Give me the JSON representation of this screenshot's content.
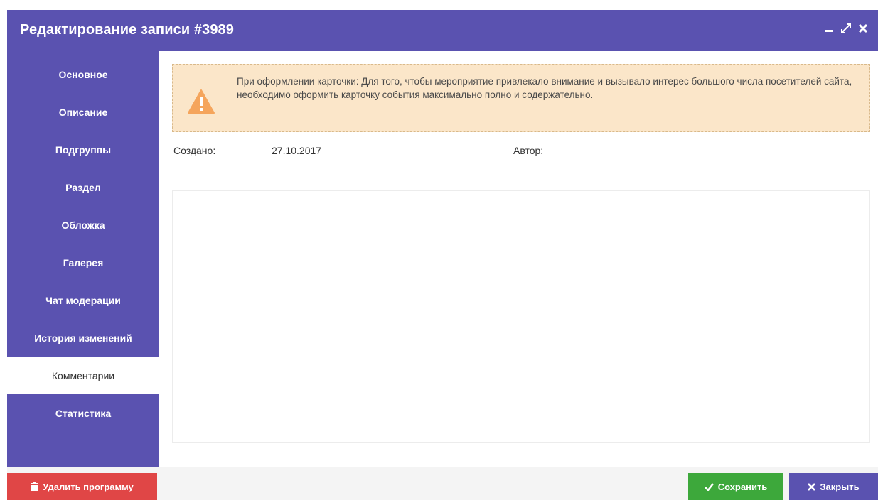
{
  "window": {
    "title": "Редактирование записи #3989",
    "controls": [
      "minimize-icon",
      "maximize-icon",
      "close-icon"
    ]
  },
  "sidebar": {
    "items": [
      {
        "label": "Основное",
        "active": false
      },
      {
        "label": "Описание",
        "active": false
      },
      {
        "label": "Подгруппы",
        "active": false
      },
      {
        "label": "Раздел",
        "active": false
      },
      {
        "label": "Обложка",
        "active": false
      },
      {
        "label": "Галерея",
        "active": false
      },
      {
        "label": "Чат модерации",
        "active": false
      },
      {
        "label": "История изменений",
        "active": false
      },
      {
        "label": "Комментарии",
        "active": true
      },
      {
        "label": "Статистика",
        "active": false
      }
    ]
  },
  "alert": {
    "icon": "warning-icon",
    "text": "При оформлении карточки: Для того, чтобы мероприятие привлекало внимание и вызывало интерес большого числа посетителей сайта, необходимо оформить карточку события максимально полно и содержательно."
  },
  "meta": {
    "created_label": "Создано:",
    "created_value": "27.10.2017",
    "author_label": "Автор:",
    "author_value": ""
  },
  "footer": {
    "delete_label": "Удалить программу",
    "save_label": "Сохранить",
    "close_label": "Закрыть"
  },
  "colors": {
    "header": "#5a52b0",
    "sidebar": "#5a52b0",
    "alert_bg": "#fbe6c9",
    "alert_icon": "#f5a55c",
    "delete": "#e04646",
    "save": "#3da83b",
    "close": "#5a52b0"
  }
}
